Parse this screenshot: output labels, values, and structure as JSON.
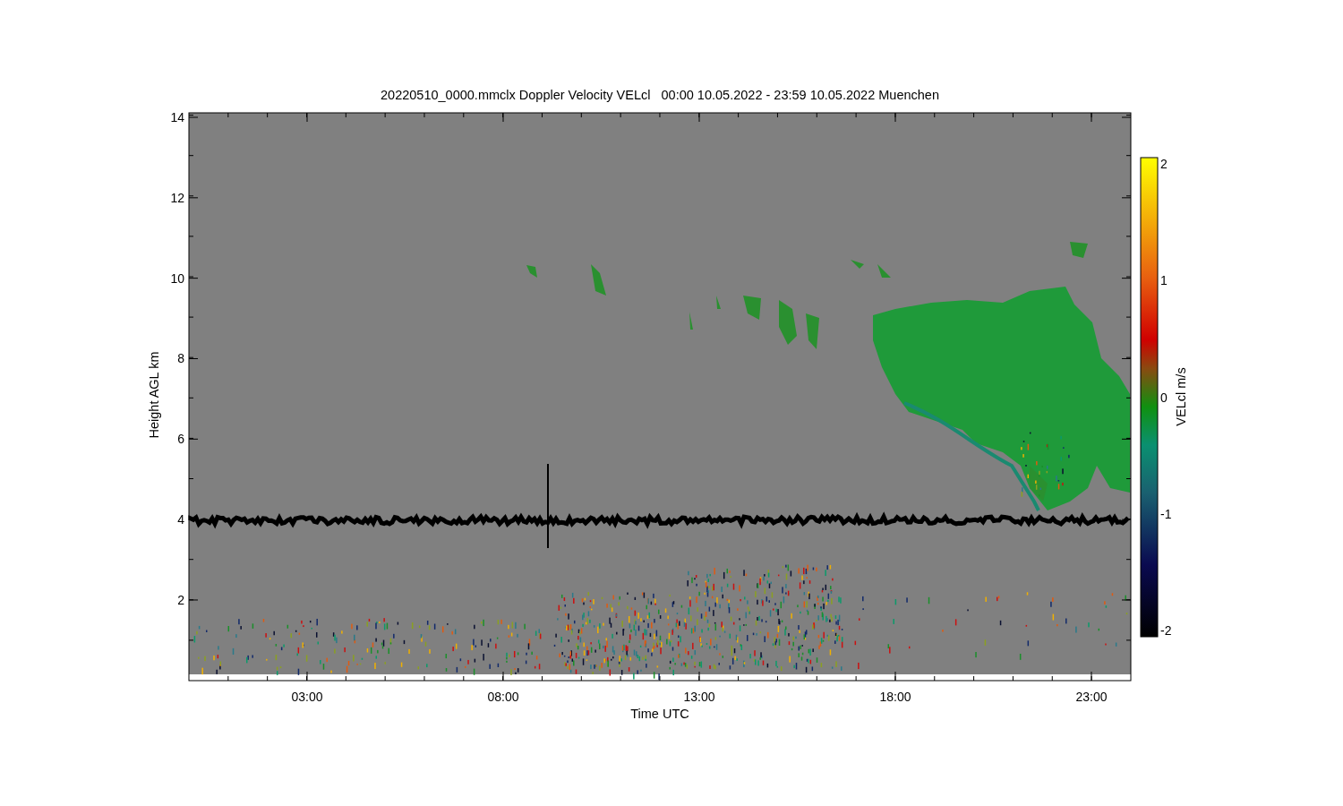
{
  "title": "20220510_0000.mmclx Doppler Velocity VELcl   00:00 10.05.2022 - 23:59 10.05.2022 Muenchen",
  "plot": {
    "x_axis": {
      "label": "Time UTC",
      "ticks": [
        "03:00",
        "08:00",
        "13:00",
        "18:00",
        "23:00"
      ]
    },
    "y_axis": {
      "label": "Height AGL km",
      "ticks": [
        "14",
        "12",
        "10",
        "8",
        "6",
        "4",
        "2"
      ]
    }
  },
  "colorbar": {
    "label": "VELcl m/s",
    "ticks": [
      "2",
      "1",
      "0",
      "-1",
      "-2"
    ]
  }
}
